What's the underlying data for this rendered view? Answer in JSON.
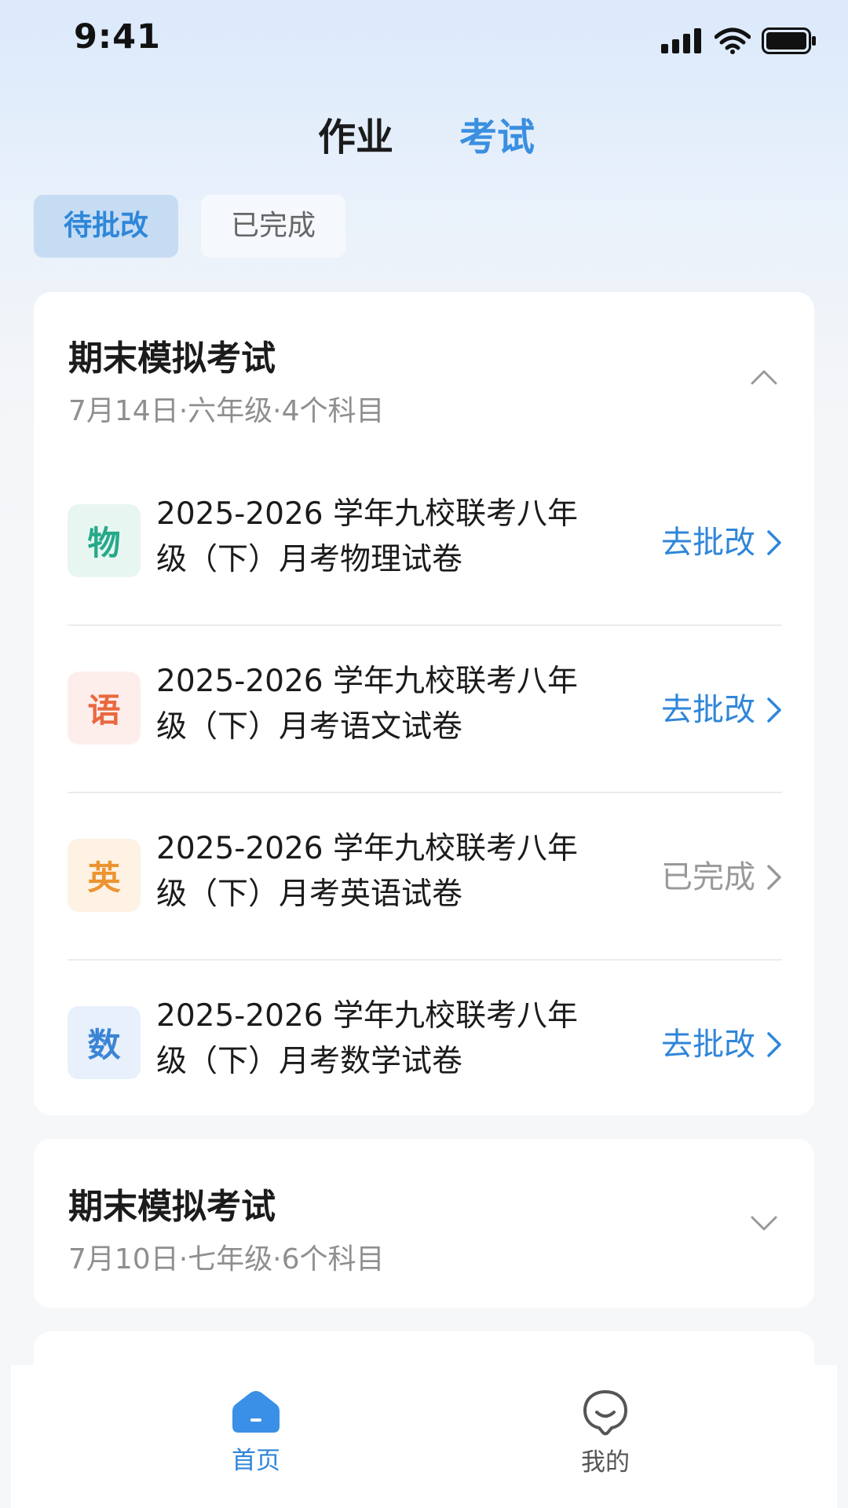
{
  "status_bar": {
    "time": "9:41",
    "icons": [
      "signal-icon",
      "wifi-icon",
      "battery-icon"
    ]
  },
  "top_tabs": [
    {
      "label": "作业",
      "active": false
    },
    {
      "label": "考试",
      "active": true
    }
  ],
  "filters": [
    {
      "label": "待批改",
      "active": true
    },
    {
      "label": "已完成",
      "active": false
    }
  ],
  "groups": [
    {
      "title": "期末模拟考试",
      "meta": "7月14日·六年级·4个科目",
      "expanded": true,
      "toggle_icon": "chevron-up-icon",
      "exams": [
        {
          "subject": "物",
          "name": "2025-2026 学年九校联考八年级（下）月考物理试卷",
          "action": "去批改",
          "status": "pending",
          "icon_bg": "#e8f6f2",
          "icon_color": "#25a98a"
        },
        {
          "subject": "语",
          "name": "2025-2026 学年九校联考八年级（下）月考语文试卷",
          "action": "去批改",
          "status": "pending",
          "icon_bg": "#fdeeec",
          "icon_color": "#e9683f"
        },
        {
          "subject": "英",
          "name": "2025-2026 学年九校联考八年级（下）月考英语试卷",
          "action": "已完成",
          "status": "done",
          "icon_bg": "#fdf2e3",
          "icon_color": "#ec9431"
        },
        {
          "subject": "数",
          "name": "2025-2026 学年九校联考八年级（下）月考数学试卷",
          "action": "去批改",
          "status": "pending",
          "icon_bg": "#e7f0fb",
          "icon_color": "#3a84d6"
        }
      ]
    },
    {
      "title": "期末模拟考试",
      "meta": "7月10日·七年级·6个科目",
      "expanded": false,
      "toggle_icon": "chevron-down-icon"
    }
  ],
  "bottom_nav": [
    {
      "label": "首页",
      "icon": "home-icon",
      "active": true
    },
    {
      "label": "我的",
      "icon": "profile-icon",
      "active": false
    }
  ],
  "colors": {
    "accent": "#2f86d9",
    "inactive_text": "#999999",
    "title_text": "#1b1b1b"
  }
}
